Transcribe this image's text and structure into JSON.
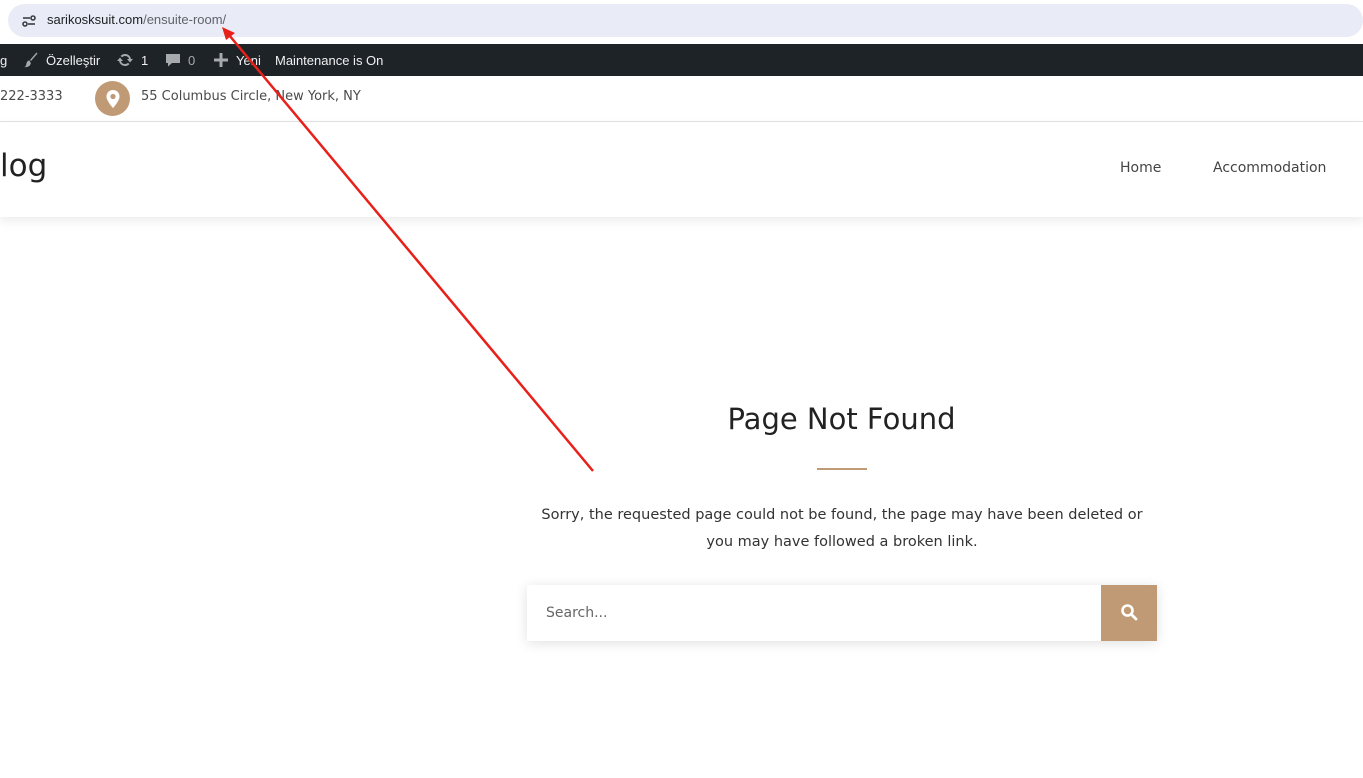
{
  "browser": {
    "url_domain": "sarikosksuit.com",
    "url_path": "/ensuite-room/"
  },
  "admin_bar": {
    "partial_left": "g",
    "customize_label": "Özelleştir",
    "updates_count": "1",
    "comments_count": "0",
    "new_label": "Yeni",
    "maintenance_label": "Maintenance is On"
  },
  "topbar": {
    "phone": "222-3333",
    "address": "55 Columbus Circle, New York, NY"
  },
  "header": {
    "logo_partial": "log",
    "nav": {
      "home": "Home",
      "accommodation": "Accommodation"
    }
  },
  "notfound": {
    "title": "Page Not Found",
    "message": "Sorry, the requested page could not be found, the page may have been deleted or you may have followed a broken link.",
    "search_placeholder": "Search..."
  },
  "colors": {
    "accent": "#bf9a74",
    "admin_bar_bg": "#1d2327",
    "annotation_arrow": "#e8201a"
  },
  "icons": [
    "site-info-icon",
    "brush-icon",
    "updates-icon",
    "comment-icon",
    "plus-icon",
    "location-pin-icon",
    "search-icon"
  ]
}
